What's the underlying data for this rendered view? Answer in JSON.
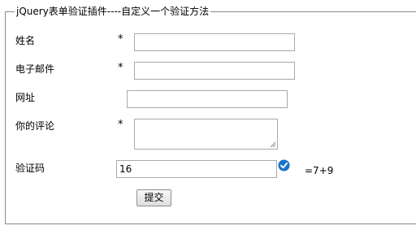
{
  "form": {
    "legend": "jQuery表单验证插件----自定义一个验证方法",
    "name_label": "姓名",
    "email_label": "电子邮件",
    "url_label": "网址",
    "comment_label": "你的评论",
    "captcha_label": "验证码",
    "required_mark": "*",
    "name_value": "",
    "email_value": "",
    "url_value": "",
    "comment_value": "",
    "captcha_value": "16",
    "captcha_hint": "=7+9",
    "submit_label": "提交",
    "valid_icon": "check-circle-icon",
    "valid_color": "#1a73c9"
  }
}
